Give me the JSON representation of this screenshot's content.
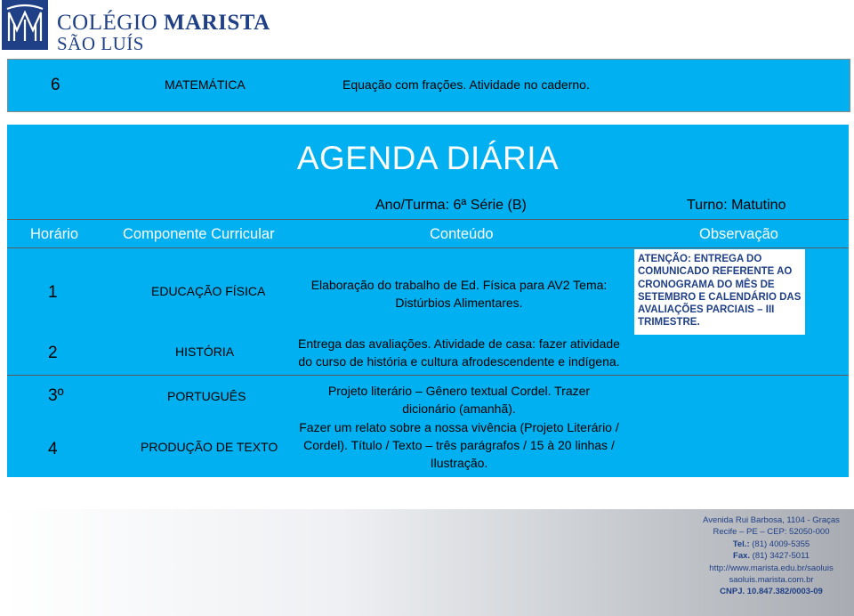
{
  "logo": {
    "line1_a": "COLÉGIO",
    "line1_b": "MARISTA",
    "line2": "SÃO LUÍS",
    "brand_color": "#1f3f86"
  },
  "top_row": {
    "number": "6",
    "subject": "MATEMÁTICA",
    "content": "Equação com frações. Atividade no caderno."
  },
  "agenda": {
    "title": "AGENDA DIÁRIA",
    "turma": "Ano/Turma: 6ª Série (B)",
    "turno": "Turno: Matutino",
    "columns": {
      "horario": "Horário",
      "componente": "Componente Curricular",
      "conteudo": "Conteúdo",
      "observacao": "Observação"
    },
    "rows": [
      {
        "horario": "1",
        "componente": "EDUCAÇÃO FÍSICA",
        "conteudo_l1": "Elaboração do trabalho de Ed. Física para AV2 Tema:",
        "conteudo_l2": "Distúrbios Alimentares."
      },
      {
        "horario": "2",
        "componente": "HISTÓRIA",
        "conteudo_l1": "Entrega das avaliações. Atividade de casa: fazer atividade",
        "conteudo_l2": "do curso de história e cultura afrodescendente e indígena."
      },
      {
        "horario": "3º",
        "componente": "PORTUGUÊS",
        "conteudo_l1": "Projeto literário – Gênero textual  Cordel. Trazer",
        "conteudo_l2": "dicionário (amanhã)."
      },
      {
        "horario": "4",
        "componente": "PRODUÇÃO DE TEXTO",
        "conteudo_l1": "Fazer um relato sobre a nossa vivência (Projeto Literário /",
        "conteudo_l2": "Cordel). Título / Texto – três parágrafos / 15 à 20 linhas /",
        "conteudo_l3": "Ilustração."
      }
    ],
    "observacao": "ATENÇÃO: ENTREGA DO COMUNICADO REFERENTE AO CRONOGRAMA DO MÊS DE SETEMBRO E CALENDÁRIO DAS AVALIAÇÕES PARCIAIS – III TRIMESTRE.",
    "background_color": "#00b0f0"
  },
  "footer": {
    "address": "Avenida Rui Barbosa, 1104 - Graças",
    "city": "Recife – PE   – CEP: 52050-000",
    "tel_label": "Tel.:",
    "tel": " (81) 4009-5355",
    "fax_label": "Fax.",
    "fax": " (81) 3427-5011",
    "site": "http://www.marista.edu.br/saoluis",
    "site2": "saoluis.marista.com.br",
    "cnpj": "CNPJ. 10.847.382/0003-09"
  }
}
